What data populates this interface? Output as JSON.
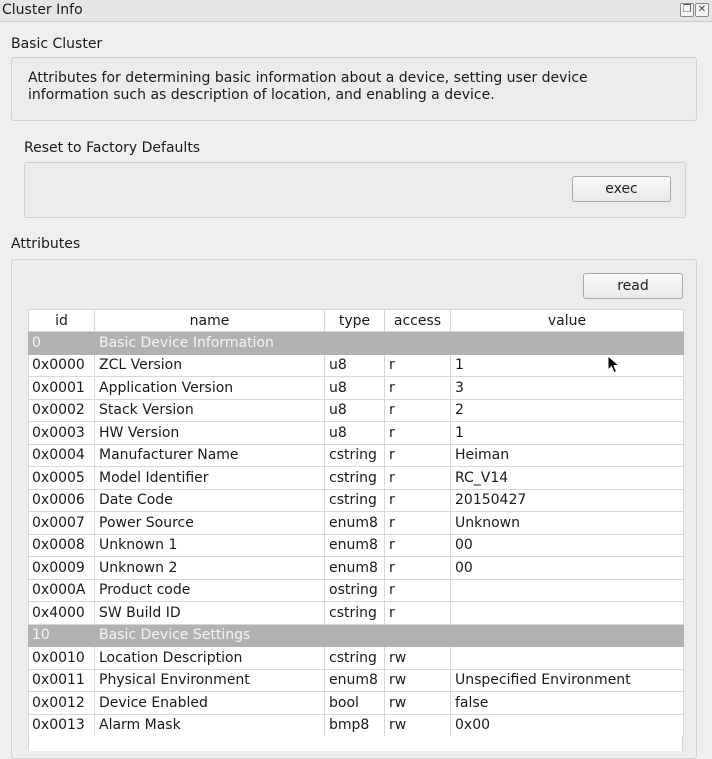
{
  "window": {
    "title": "Cluster Info",
    "float_icon": "float-icon",
    "close_icon": "close-icon"
  },
  "cluster": {
    "name": "Basic Cluster",
    "description_line1": "Attributes for determining basic information about a device, setting user device",
    "description_line2": "information such as description of location, and enabling a device."
  },
  "reset": {
    "label": "Reset to Factory Defaults",
    "button": "exec"
  },
  "attributes": {
    "label": "Attributes",
    "read_button": "read",
    "columns": [
      "id",
      "name",
      "type",
      "access",
      "value"
    ],
    "rows": [
      {
        "group": true,
        "id": "0",
        "name": "Basic Device Information"
      },
      {
        "id": "0x0000",
        "name": "ZCL Version",
        "type": "u8",
        "access": "r",
        "value": "1"
      },
      {
        "id": "0x0001",
        "name": "Application Version",
        "type": "u8",
        "access": "r",
        "value": "3"
      },
      {
        "id": "0x0002",
        "name": "Stack Version",
        "type": "u8",
        "access": "r",
        "value": "2"
      },
      {
        "id": "0x0003",
        "name": "HW Version",
        "type": "u8",
        "access": "r",
        "value": "1"
      },
      {
        "id": "0x0004",
        "name": "Manufacturer Name",
        "type": "cstring",
        "access": "r",
        "value": "Heiman"
      },
      {
        "id": "0x0005",
        "name": "Model Identifier",
        "type": "cstring",
        "access": "r",
        "value": "RC_V14"
      },
      {
        "id": "0x0006",
        "name": "Date Code",
        "type": "cstring",
        "access": "r",
        "value": "20150427"
      },
      {
        "id": "0x0007",
        "name": "Power Source",
        "type": "enum8",
        "access": "r",
        "value": "Unknown"
      },
      {
        "id": "0x0008",
        "name": "Unknown 1",
        "type": "enum8",
        "access": "r",
        "value": "00"
      },
      {
        "id": "0x0009",
        "name": "Unknown 2",
        "type": "enum8",
        "access": "r",
        "value": "00"
      },
      {
        "id": "0x000A",
        "name": "Product code",
        "type": "ostring",
        "access": "r",
        "value": ""
      },
      {
        "id": "0x4000",
        "name": "SW Build ID",
        "type": "cstring",
        "access": "r",
        "value": ""
      },
      {
        "group": true,
        "id": "10",
        "name": "Basic Device Settings"
      },
      {
        "id": "0x0010",
        "name": "Location Description",
        "type": "cstring",
        "access": "rw",
        "value": ""
      },
      {
        "id": "0x0011",
        "name": "Physical Environment",
        "type": "enum8",
        "access": "rw",
        "value": "Unspecified Environment"
      },
      {
        "id": "0x0012",
        "name": "Device Enabled",
        "type": "bool",
        "access": "rw",
        "value": "false"
      },
      {
        "id": "0x0013",
        "name": "Alarm Mask",
        "type": "bmp8",
        "access": "rw",
        "value": "0x00"
      }
    ]
  },
  "colors": {
    "group_row": "#b2b2b2",
    "panel": "#efefef"
  }
}
